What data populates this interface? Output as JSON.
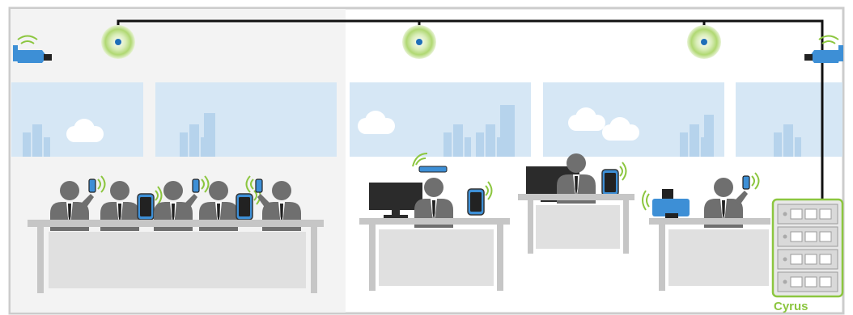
{
  "server": {
    "label": "Cyrus",
    "units": 4
  },
  "colors": {
    "room_frame": "#cccccc",
    "left_room_bg": "#f3f3f3",
    "window_sky": "#d6e7f5",
    "city": "#b6d3ec",
    "person": "#6f6f6f",
    "desk": "#c6c6c6",
    "desk_front": "#e0e0e0",
    "device_blue": "#3d8fd6",
    "signal_green": "#8cc63f",
    "server_bg": "#e8e8e8",
    "cable": "#111111"
  },
  "icons": {
    "camera": "security-camera-icon",
    "sensor": "wireless-beacon-icon",
    "printer": "printer-icon",
    "phone": "smartphone-icon",
    "glasses": "smart-glasses-icon",
    "monitor": "monitor-icon",
    "server": "server-rack-icon"
  }
}
